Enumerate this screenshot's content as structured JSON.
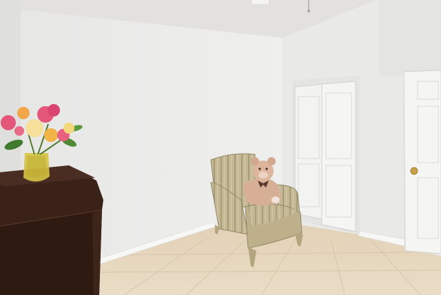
{
  "scene": {
    "description_label": "",
    "colors": {
      "wall_light": "#ebebea",
      "wall_shadow": "#dedddb",
      "ceiling": "#e6e5e2",
      "floor": "#e6d6bd",
      "baseboard": "#f6f6f5",
      "dresser": "#3a2118",
      "door": "#f3f3f2",
      "chair": "#c2b592",
      "teddy": "#d9b29a",
      "vase": "#d8c64a",
      "flowers_pink": "#e4577a",
      "flowers_yellow": "#f2c94c",
      "knob": "#c9a24a"
    },
    "icons": [
      "ceiling-fan-icon",
      "flower-vase-icon",
      "teddy-bear-icon",
      "armchair-icon",
      "door-knob-icon"
    ]
  }
}
